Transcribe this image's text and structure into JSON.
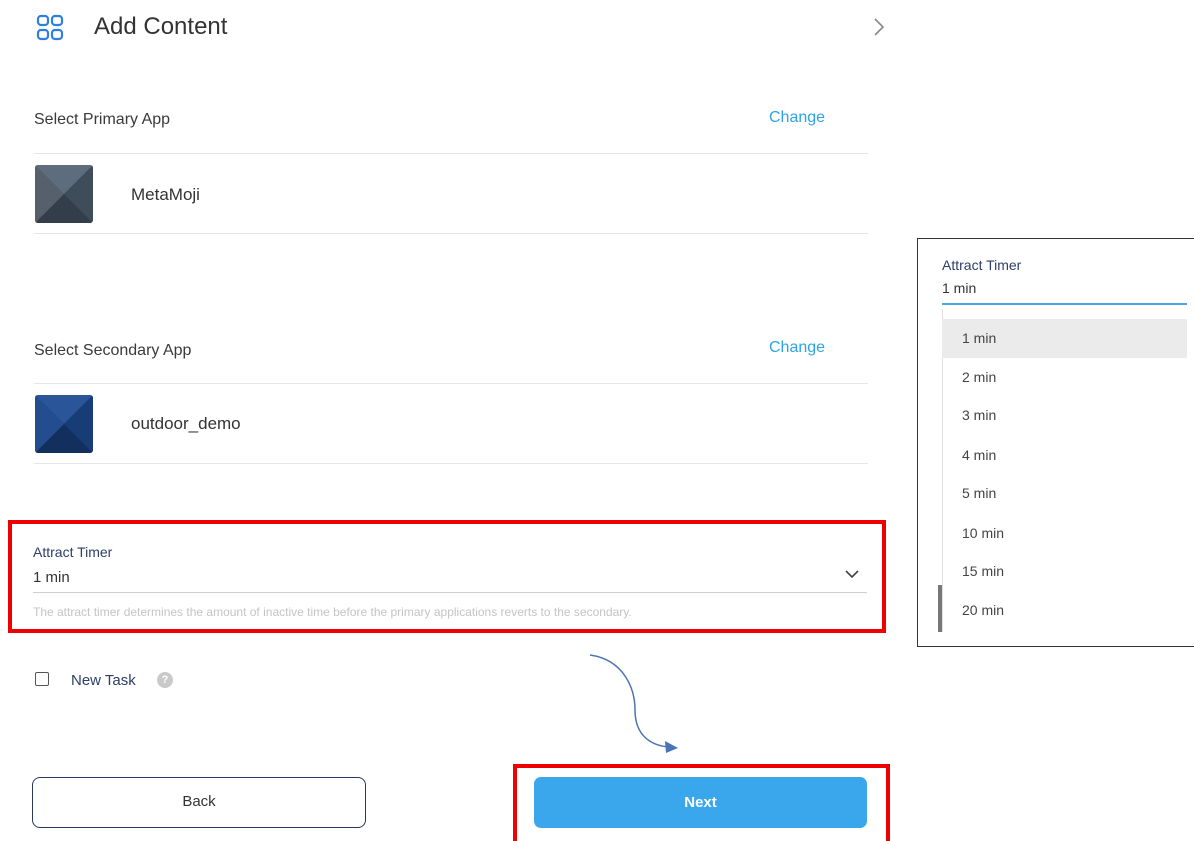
{
  "header": {
    "title": "Add Content"
  },
  "primary_app": {
    "label": "Select Primary App",
    "change_label": "Change",
    "name": "MetaMoji"
  },
  "secondary_app": {
    "label": "Select Secondary App",
    "change_label": "Change",
    "name": "outdoor_demo"
  },
  "attract_timer": {
    "label": "Attract Timer",
    "value": "1 min",
    "helper": "The attract timer determines the amount of inactive time before the primary applications reverts to the secondary."
  },
  "new_task": {
    "label": "New Task",
    "checked": false
  },
  "buttons": {
    "back": "Back",
    "next": "Next"
  },
  "dropdown": {
    "label": "Attract Timer",
    "value": "1 min",
    "options": [
      "1 min",
      "2 min",
      "3 min",
      "4 min",
      "5 min",
      "10 min",
      "15 min",
      "20 min"
    ],
    "selected_index": 0
  },
  "colors": {
    "accent": "#2ea3e6",
    "next_button": "#3aa7ec",
    "highlight": "#ef0000",
    "label": "#2d3e68"
  }
}
